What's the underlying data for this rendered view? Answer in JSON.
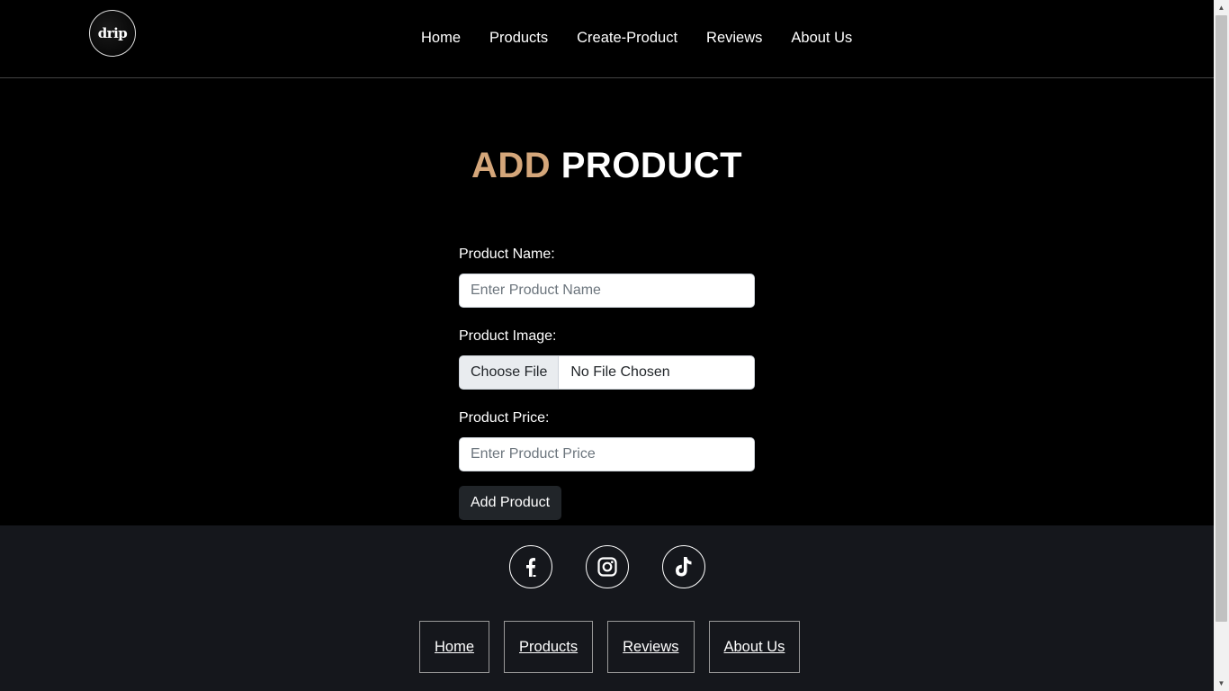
{
  "header": {
    "logo_text": "drip",
    "nav": [
      "Home",
      "Products",
      "Create-Product",
      "Reviews",
      "About Us"
    ]
  },
  "title": {
    "accent": "ADD",
    "main": "PRODUCT"
  },
  "form": {
    "name_label": "Product Name:",
    "name_placeholder": "Enter Product Name",
    "image_label": "Product Image:",
    "file_button": "Choose File",
    "file_status": "No File Chosen",
    "price_label": "Product Price:",
    "price_placeholder": "Enter Product Price",
    "submit_label": "Add Product"
  },
  "footer": {
    "social_icons": [
      "facebook-icon",
      "instagram-icon",
      "tiktok-icon"
    ],
    "links": [
      "Home",
      "Products",
      "Reviews",
      "About Us"
    ]
  },
  "colors": {
    "background": "#000000",
    "footer_background": "#15171c",
    "title_accent": "#d4a67a",
    "button_dark": "#212529"
  }
}
